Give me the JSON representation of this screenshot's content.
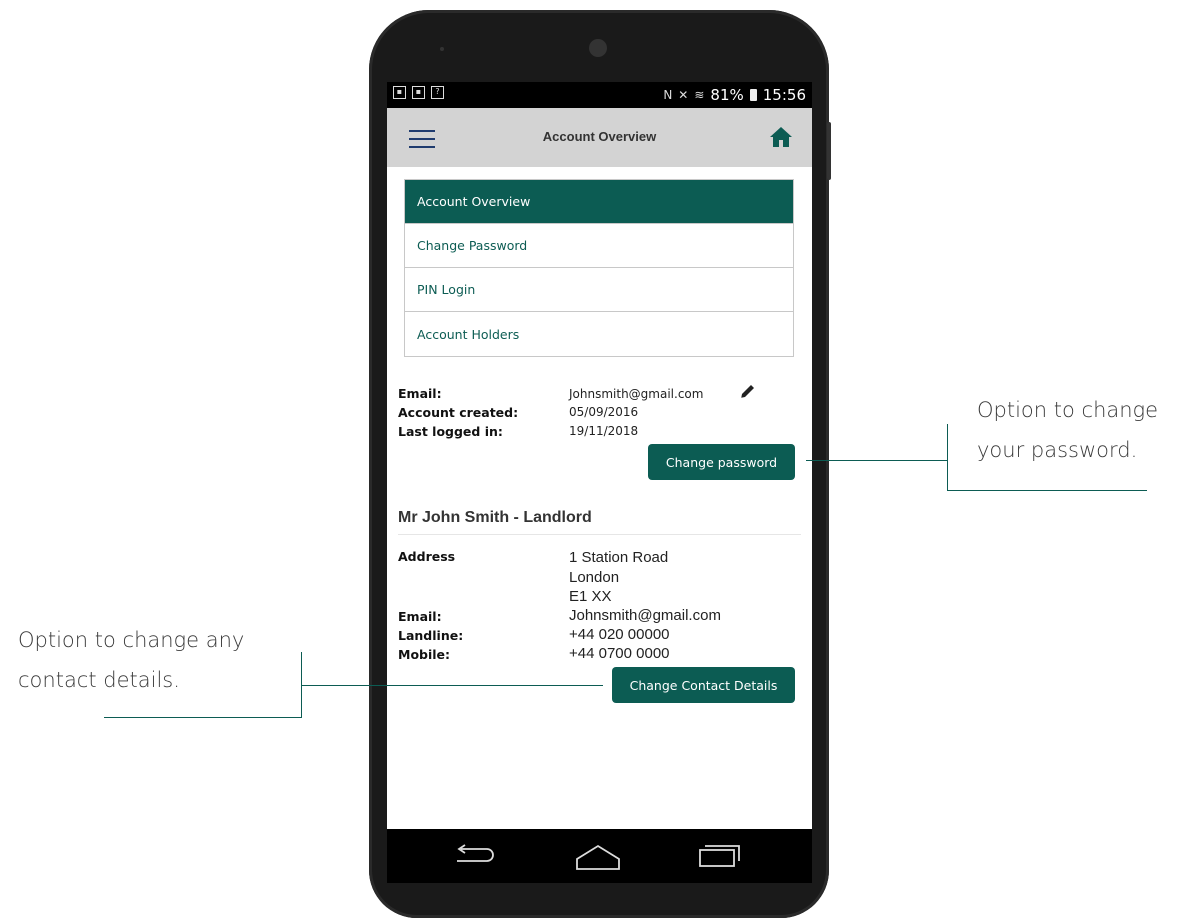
{
  "statusbar": {
    "battery": "81%",
    "time": "15:56"
  },
  "appbar": {
    "title": "Account Overview"
  },
  "menu": {
    "items": [
      {
        "label": "Account Overview",
        "active": true
      },
      {
        "label": "Change Password",
        "active": false
      },
      {
        "label": "PIN Login",
        "active": false
      },
      {
        "label": "Account Holders",
        "active": false
      }
    ]
  },
  "account": {
    "email_label": "Email:",
    "email_value": "Johnsmith@gmail.com",
    "created_label": "Account created:",
    "created_value": "05/09/2016",
    "last_login_label": "Last logged in:",
    "last_login_value": "19/11/2018",
    "change_password_label": "Change password"
  },
  "contact": {
    "title": "Mr John Smith - Landlord",
    "address_label": "Address",
    "address_lines": [
      "1 Station Road",
      "London",
      "E1 XX"
    ],
    "email_label": "Email:",
    "email_value": "Johnsmith@gmail.com",
    "landline_label": "Landline:",
    "landline_value": "+44 020 00000",
    "mobile_label": "Mobile:",
    "mobile_value": "+44 0700 0000",
    "change_contact_label": "Change Contact Details"
  },
  "annotations": {
    "password_line1": "Option to change",
    "password_line2": "your password.",
    "contact_line1": "Option to change any",
    "contact_line2": "contact details."
  },
  "colors": {
    "accent": "#0c5c53",
    "appbar": "#d3d3d3"
  },
  "icons": [
    "hamburger-icon",
    "home-icon",
    "pencil-icon",
    "back-icon",
    "home-nav-icon",
    "recents-icon"
  ]
}
